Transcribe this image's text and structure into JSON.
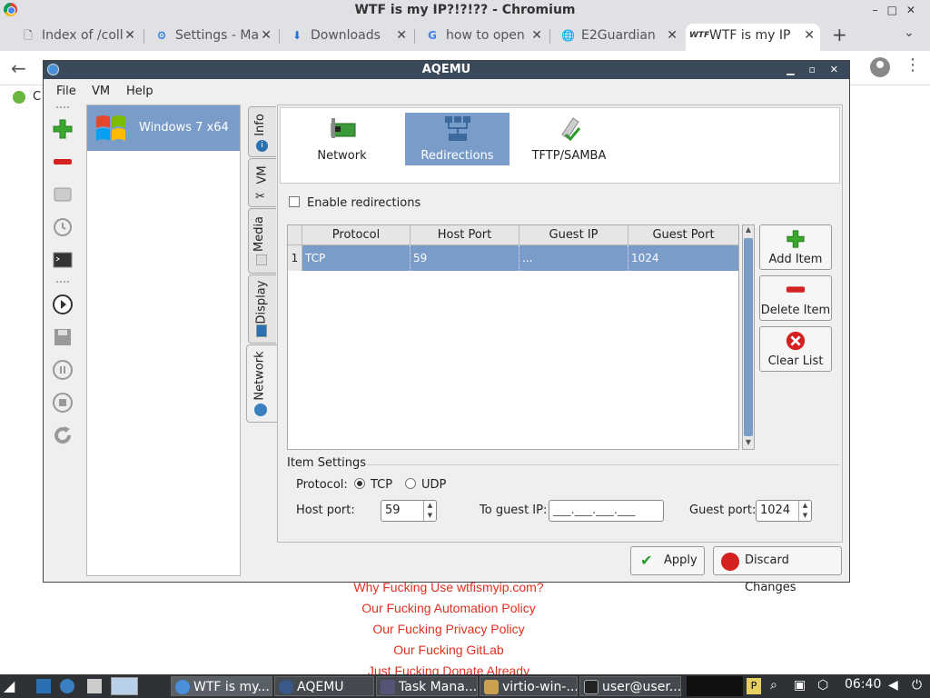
{
  "browser": {
    "window_title": "WTF is my IP?!?!?? - Chromium",
    "tabs": [
      {
        "label": "Index of /coll",
        "icon": "file-icon"
      },
      {
        "label": "Settings - Ma",
        "icon": "gear-icon"
      },
      {
        "label": "Downloads",
        "icon": "download-icon"
      },
      {
        "label": "how to open",
        "icon": "google-icon"
      },
      {
        "label": "E2Guardian",
        "icon": "globe-icon"
      },
      {
        "label": "WTF is my IP",
        "icon": "wtf-icon"
      }
    ],
    "bookmark_text": "C"
  },
  "page_links": [
    "Why Fucking Use wtfismyip.com?",
    "Our Fucking Automation Policy",
    "Our Fucking Privacy Policy",
    "Our Fucking GitLab",
    "Just Fucking Donate Already"
  ],
  "aqemu": {
    "title": "AQEMU",
    "menu": [
      "File",
      "VM",
      "Help"
    ],
    "vm_name": "Windows 7 x64",
    "side_tabs": [
      "Info",
      "VM",
      "Media",
      "Display",
      "Network"
    ],
    "network_tabs": [
      "Network",
      "Redirections",
      "TFTP/SAMBA"
    ],
    "enable_redirections": "Enable redirections",
    "table": {
      "headers": [
        "Protocol",
        "Host Port",
        "Guest IP",
        "Guest Port"
      ],
      "rows": [
        {
          "num": "1",
          "cells": [
            "TCP",
            "59",
            "...",
            "1024"
          ]
        }
      ]
    },
    "buttons": {
      "add": "Add Item",
      "delete": "Delete Item",
      "clear": "Clear List",
      "apply": "Apply",
      "discard": "Discard Changes"
    },
    "item_settings": {
      "title": "Item Settings",
      "protocol_label": "Protocol:",
      "tcp": "TCP",
      "udp": "UDP",
      "host_port_label": "Host port:",
      "host_port": "59",
      "guest_ip_label": "To guest IP:",
      "guest_ip": "___.___.___.___",
      "guest_port_label": "Guest port:",
      "guest_port": "1024"
    }
  },
  "taskbar": {
    "tasks": [
      "WTF is my...",
      "AQEMU",
      "Task Mana...",
      "virtio-win-...",
      "user@user..."
    ],
    "clock": "06:40"
  }
}
